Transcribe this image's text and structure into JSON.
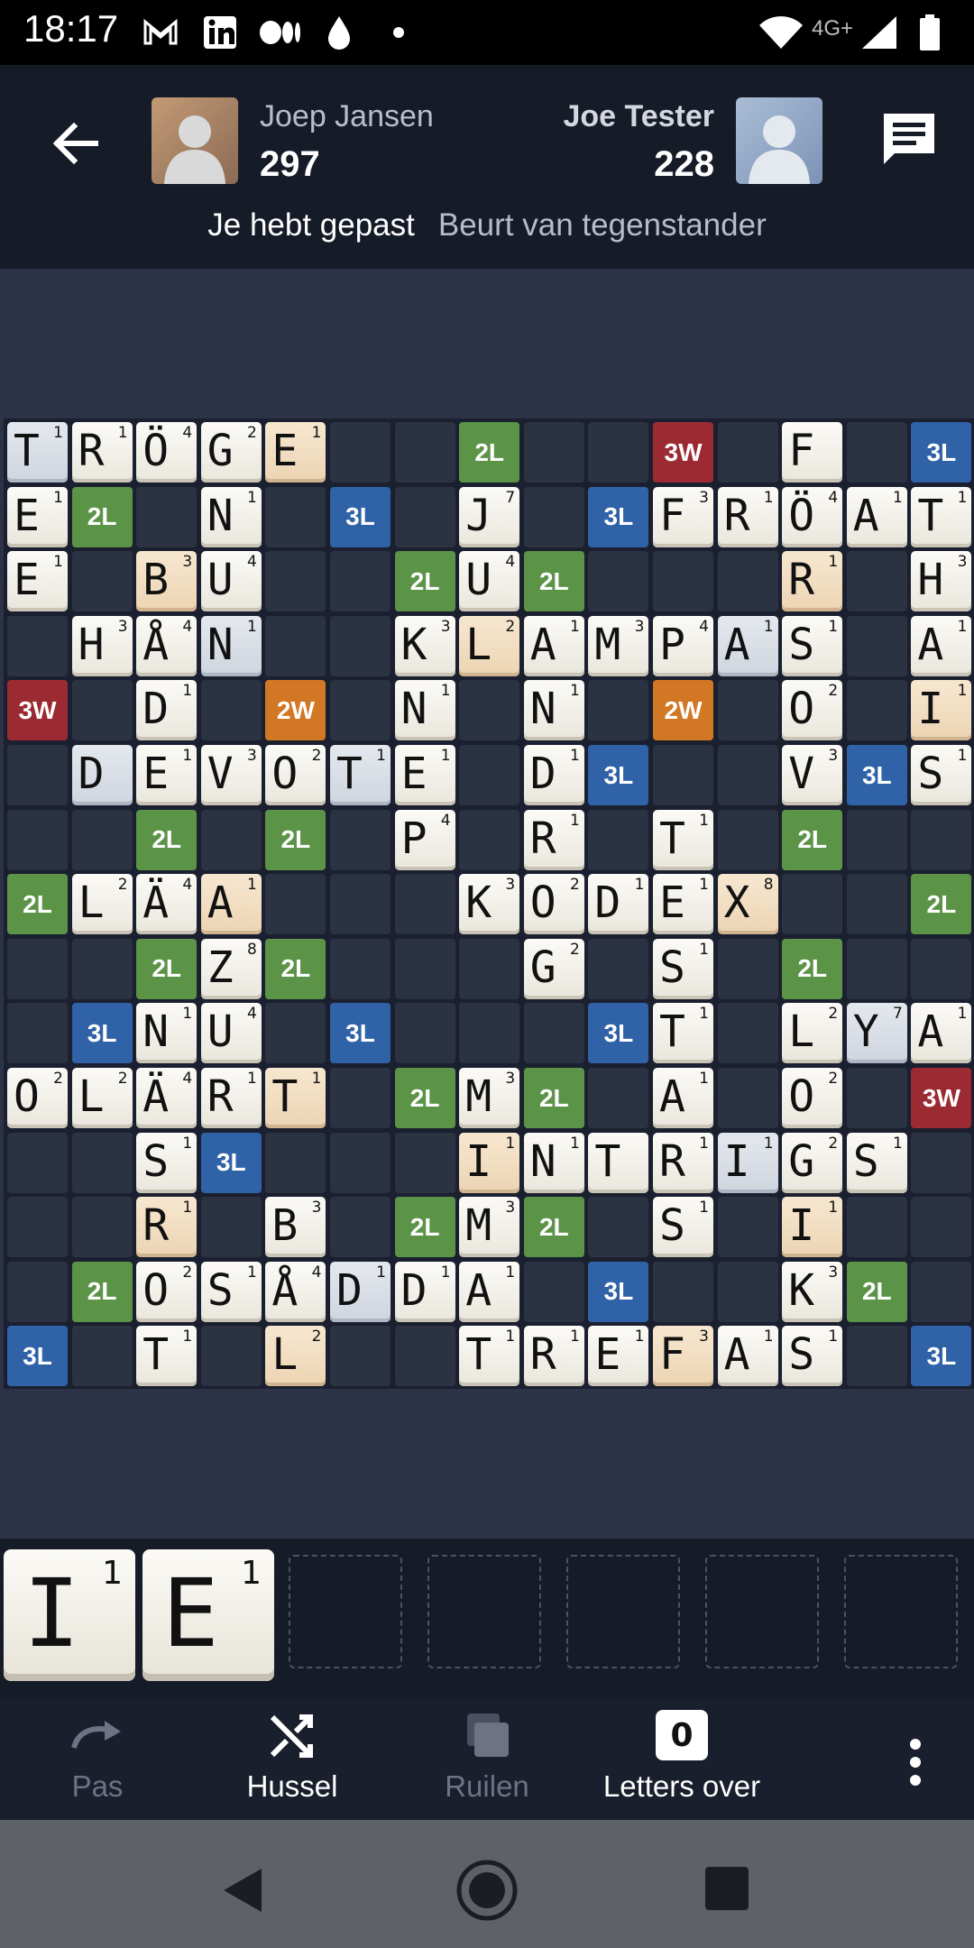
{
  "status_bar": {
    "time": "18:17",
    "network_label": "4G+",
    "icons": [
      "gmail-icon",
      "linkedin-icon",
      "medium-icon",
      "drop-icon",
      "dot-icon",
      "wifi-icon",
      "signal-icon",
      "battery-icon"
    ]
  },
  "header": {
    "player_left": {
      "name": "Joep Jansen",
      "score": "297"
    },
    "player_right": {
      "name": "Joe Tester",
      "score": "228"
    },
    "status_me": "Je hebt gepast",
    "status_turn": "Beurt van tegenstander"
  },
  "board": {
    "premium_labels": {
      "2L": "2L",
      "3L": "3L",
      "2W": "2W",
      "3W": "3W"
    },
    "colors": {
      "2L": "#5b9347",
      "3L": "#2f62a6",
      "2W": "#d27723",
      "3W": "#9c2a32"
    },
    "premiums": [
      [
        0,
        7,
        "2L"
      ],
      [
        0,
        10,
        "3W"
      ],
      [
        0,
        14,
        "3L"
      ],
      [
        1,
        1,
        "2L"
      ],
      [
        1,
        5,
        "3L"
      ],
      [
        1,
        9,
        "3L"
      ],
      [
        2,
        6,
        "2L"
      ],
      [
        2,
        8,
        "2L"
      ],
      [
        4,
        0,
        "3W"
      ],
      [
        4,
        4,
        "2W"
      ],
      [
        4,
        10,
        "2W"
      ],
      [
        5,
        9,
        "3L"
      ],
      [
        5,
        13,
        "3L"
      ],
      [
        6,
        2,
        "2L"
      ],
      [
        6,
        4,
        "2L"
      ],
      [
        6,
        12,
        "2L"
      ],
      [
        7,
        0,
        "2L"
      ],
      [
        7,
        14,
        "2L"
      ],
      [
        8,
        2,
        "2L"
      ],
      [
        8,
        4,
        "2L"
      ],
      [
        8,
        12,
        "2L"
      ],
      [
        9,
        1,
        "3L"
      ],
      [
        9,
        5,
        "3L"
      ],
      [
        9,
        9,
        "3L"
      ],
      [
        10,
        6,
        "2L"
      ],
      [
        10,
        8,
        "2L"
      ],
      [
        10,
        14,
        "3W"
      ],
      [
        11,
        3,
        "3L"
      ],
      [
        12,
        6,
        "2L"
      ],
      [
        12,
        8,
        "2L"
      ],
      [
        13,
        1,
        "2L"
      ],
      [
        13,
        9,
        "3L"
      ],
      [
        13,
        13,
        "2L"
      ],
      [
        14,
        0,
        "3L"
      ],
      [
        14,
        14,
        "3L"
      ]
    ],
    "tiles": [
      [
        0,
        0,
        "T",
        "1",
        "grey"
      ],
      [
        0,
        1,
        "R",
        "1",
        ""
      ],
      [
        0,
        2,
        "Ö",
        "4",
        ""
      ],
      [
        0,
        3,
        "G",
        "2",
        ""
      ],
      [
        0,
        4,
        "E",
        "1",
        "recent"
      ],
      [
        0,
        12,
        "F",
        "",
        ""
      ],
      [
        1,
        0,
        "E",
        "1",
        ""
      ],
      [
        1,
        3,
        "N",
        "1",
        ""
      ],
      [
        1,
        7,
        "J",
        "7",
        ""
      ],
      [
        1,
        10,
        "F",
        "3",
        ""
      ],
      [
        1,
        11,
        "R",
        "1",
        ""
      ],
      [
        1,
        12,
        "Ö",
        "4",
        ""
      ],
      [
        1,
        13,
        "A",
        "1",
        ""
      ],
      [
        1,
        14,
        "T",
        "1",
        ""
      ],
      [
        2,
        0,
        "E",
        "1",
        ""
      ],
      [
        2,
        2,
        "B",
        "3",
        "recent"
      ],
      [
        2,
        3,
        "U",
        "4",
        ""
      ],
      [
        2,
        7,
        "U",
        "4",
        ""
      ],
      [
        2,
        12,
        "R",
        "1",
        "recent"
      ],
      [
        2,
        14,
        "H",
        "3",
        ""
      ],
      [
        3,
        1,
        "H",
        "3",
        ""
      ],
      [
        3,
        2,
        "Å",
        "4",
        ""
      ],
      [
        3,
        3,
        "N",
        "1",
        "grey"
      ],
      [
        3,
        6,
        "K",
        "3",
        ""
      ],
      [
        3,
        7,
        "L",
        "2",
        "recent"
      ],
      [
        3,
        8,
        "A",
        "1",
        ""
      ],
      [
        3,
        9,
        "M",
        "3",
        ""
      ],
      [
        3,
        10,
        "P",
        "4",
        ""
      ],
      [
        3,
        11,
        "A",
        "1",
        "grey"
      ],
      [
        3,
        12,
        "S",
        "1",
        ""
      ],
      [
        3,
        14,
        "A",
        "1",
        ""
      ],
      [
        4,
        2,
        "D",
        "1",
        ""
      ],
      [
        4,
        6,
        "N",
        "1",
        ""
      ],
      [
        4,
        8,
        "N",
        "1",
        ""
      ],
      [
        4,
        12,
        "O",
        "2",
        ""
      ],
      [
        4,
        14,
        "I",
        "1",
        "recent"
      ],
      [
        5,
        1,
        "D",
        "",
        "grey"
      ],
      [
        5,
        2,
        "E",
        "1",
        ""
      ],
      [
        5,
        3,
        "V",
        "3",
        ""
      ],
      [
        5,
        4,
        "O",
        "2",
        ""
      ],
      [
        5,
        5,
        "T",
        "1",
        "grey"
      ],
      [
        5,
        6,
        "E",
        "1",
        ""
      ],
      [
        5,
        8,
        "D",
        "1",
        ""
      ],
      [
        5,
        12,
        "V",
        "3",
        ""
      ],
      [
        5,
        14,
        "S",
        "1",
        ""
      ],
      [
        6,
        6,
        "P",
        "4",
        ""
      ],
      [
        6,
        8,
        "R",
        "1",
        ""
      ],
      [
        6,
        10,
        "T",
        "1",
        ""
      ],
      [
        7,
        1,
        "L",
        "2",
        ""
      ],
      [
        7,
        2,
        "Ä",
        "4",
        ""
      ],
      [
        7,
        3,
        "A",
        "1",
        "recent"
      ],
      [
        7,
        7,
        "K",
        "3",
        ""
      ],
      [
        7,
        8,
        "O",
        "2",
        ""
      ],
      [
        7,
        9,
        "D",
        "1",
        ""
      ],
      [
        7,
        10,
        "E",
        "1",
        ""
      ],
      [
        7,
        11,
        "X",
        "8",
        "recent"
      ],
      [
        8,
        3,
        "Z",
        "8",
        ""
      ],
      [
        8,
        8,
        "G",
        "2",
        ""
      ],
      [
        8,
        10,
        "S",
        "1",
        ""
      ],
      [
        9,
        2,
        "N",
        "1",
        ""
      ],
      [
        9,
        3,
        "U",
        "4",
        ""
      ],
      [
        9,
        10,
        "T",
        "1",
        ""
      ],
      [
        9,
        12,
        "L",
        "2",
        ""
      ],
      [
        9,
        13,
        "Y",
        "7",
        "grey"
      ],
      [
        9,
        14,
        "A",
        "1",
        ""
      ],
      [
        10,
        0,
        "O",
        "2",
        ""
      ],
      [
        10,
        1,
        "L",
        "2",
        ""
      ],
      [
        10,
        2,
        "Ä",
        "4",
        ""
      ],
      [
        10,
        3,
        "R",
        "1",
        ""
      ],
      [
        10,
        4,
        "T",
        "1",
        "recent"
      ],
      [
        10,
        7,
        "M",
        "3",
        ""
      ],
      [
        10,
        10,
        "A",
        "1",
        ""
      ],
      [
        10,
        12,
        "O",
        "2",
        ""
      ],
      [
        11,
        2,
        "S",
        "1",
        ""
      ],
      [
        11,
        7,
        "I",
        "1",
        "recent"
      ],
      [
        11,
        8,
        "N",
        "1",
        ""
      ],
      [
        11,
        9,
        "T",
        "",
        ""
      ],
      [
        11,
        10,
        "R",
        "1",
        ""
      ],
      [
        11,
        11,
        "I",
        "1",
        "grey"
      ],
      [
        11,
        12,
        "G",
        "2",
        ""
      ],
      [
        11,
        13,
        "S",
        "1",
        ""
      ],
      [
        12,
        2,
        "R",
        "1",
        "recent"
      ],
      [
        12,
        4,
        "B",
        "3",
        ""
      ],
      [
        12,
        7,
        "M",
        "3",
        ""
      ],
      [
        12,
        10,
        "S",
        "1",
        ""
      ],
      [
        12,
        12,
        "I",
        "1",
        "recent"
      ],
      [
        13,
        2,
        "O",
        "2",
        ""
      ],
      [
        13,
        3,
        "S",
        "1",
        ""
      ],
      [
        13,
        4,
        "Å",
        "4",
        ""
      ],
      [
        13,
        5,
        "D",
        "1",
        "grey"
      ],
      [
        13,
        6,
        "D",
        "1",
        ""
      ],
      [
        13,
        7,
        "A",
        "1",
        ""
      ],
      [
        13,
        12,
        "K",
        "3",
        ""
      ],
      [
        14,
        2,
        "T",
        "1",
        ""
      ],
      [
        14,
        4,
        "L",
        "2",
        "recent"
      ],
      [
        14,
        7,
        "T",
        "1",
        ""
      ],
      [
        14,
        8,
        "R",
        "1",
        ""
      ],
      [
        14,
        9,
        "E",
        "1",
        ""
      ],
      [
        14,
        10,
        "F",
        "3",
        "recent"
      ],
      [
        14,
        11,
        "A",
        "1",
        ""
      ],
      [
        14,
        12,
        "S",
        "1",
        ""
      ]
    ]
  },
  "rack": {
    "tiles": [
      {
        "letter": "I",
        "value": "1"
      },
      {
        "letter": "E",
        "value": "1"
      }
    ],
    "empty_slots": 5
  },
  "toolbar": {
    "pass_label": "Pas",
    "shuffle_label": "Hussel",
    "swap_label": "Ruilen",
    "letters_left_label": "Letters over",
    "letters_left_count": "0"
  }
}
